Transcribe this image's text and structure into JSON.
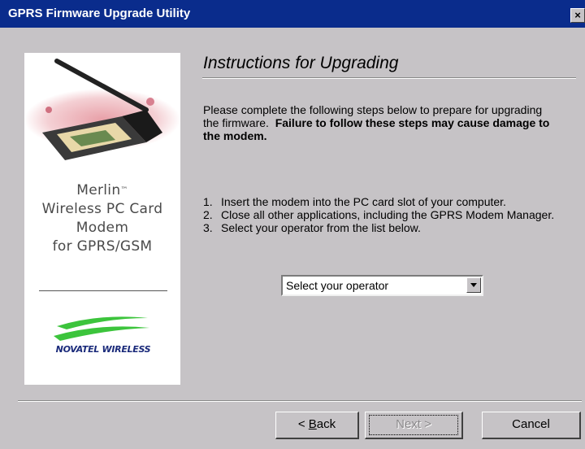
{
  "window": {
    "title": "GPRS Firmware Upgrade Utility",
    "close_glyph": "×"
  },
  "side_panel": {
    "product_name_lines": [
      "Merlin",
      "Wireless PC Card",
      "Modem",
      "for GPRS/GSM"
    ],
    "trademark": "™",
    "logo_text": "NOVATEL WIRELESS"
  },
  "content": {
    "heading": "Instructions for Upgrading",
    "intro_normal": "Please complete the following steps below to prepare for upgrading the firmware.",
    "intro_bold": "Failure to follow these steps may cause damage to the modem.",
    "steps": [
      {
        "num": "1.",
        "text": "Insert the modem into the PC card slot of your computer."
      },
      {
        "num": "2.",
        "text": "Close all other applications, including the GPRS Modem Manager."
      },
      {
        "num": "3.",
        "text": "Select your operator from the list below."
      }
    ],
    "operator_select": {
      "value": "Select your operator"
    }
  },
  "buttons": {
    "back_prefix": "< ",
    "back_mnemonic": "B",
    "back_rest": "ack",
    "next_label": "Next >",
    "next_enabled": false,
    "cancel_label": "Cancel"
  },
  "colors": {
    "titlebar": "#0a2c8c",
    "dialog_face": "#c6c3c6",
    "logo_green": "#3cc43c",
    "logo_blue": "#1a2a7a"
  }
}
